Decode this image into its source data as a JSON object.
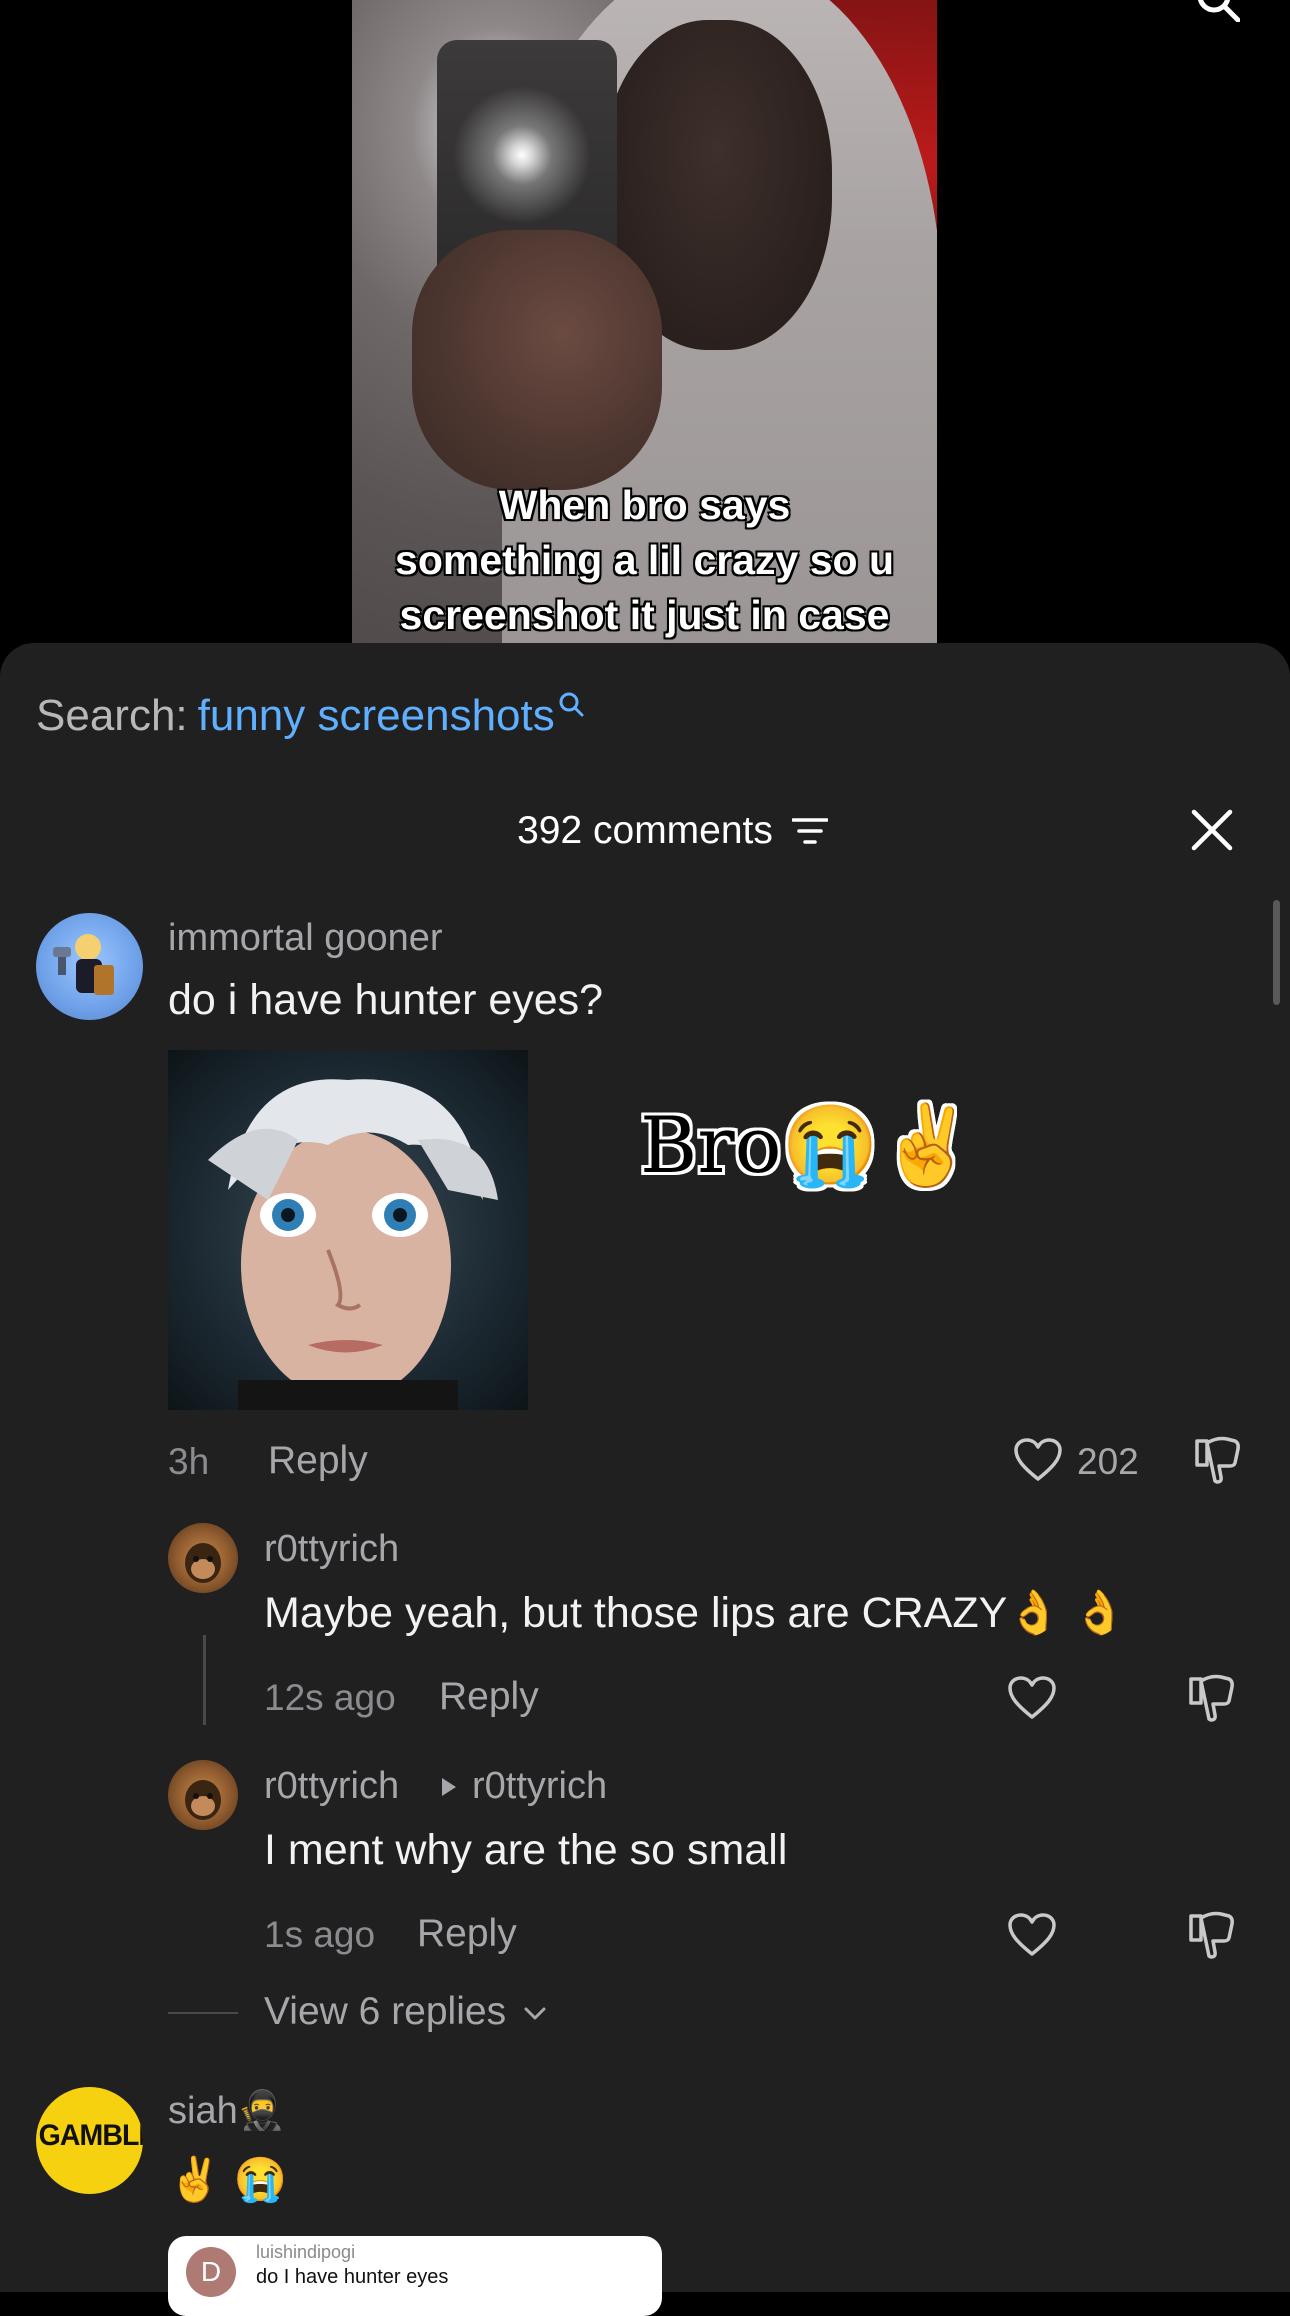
{
  "video": {
    "caption": "When bro says\nsomething a lil crazy so u\nscreenshot it just in case"
  },
  "search": {
    "prefix": "Search:",
    "term": "funny screenshots"
  },
  "comments_header": {
    "title": "392 comments"
  },
  "comments": [
    {
      "username": "immortal gooner",
      "text": "do i have hunter eyes?",
      "sticker_text": "Bro😭✌️",
      "time": "3h",
      "reply_label": "Reply",
      "likes": "202",
      "replies": [
        {
          "username": "r0ttyrich",
          "text": "Maybe yeah, but those lips are CRAZY👌 👌",
          "time": "12s ago",
          "reply_label": "Reply"
        },
        {
          "username": "r0ttyrich",
          "reply_to": "r0ttyrich",
          "text": "I ment why are the so small",
          "time": "1s ago",
          "reply_label": "Reply"
        }
      ],
      "view_replies": "View 6 replies"
    },
    {
      "username": "siah🥷",
      "avatar_text": "GAMBLING",
      "text": "✌️ 😭",
      "quoted": {
        "avatar_letter": "D",
        "username": "luishindipogi",
        "text": "do I have hunter eyes"
      }
    }
  ],
  "icons": {
    "search": "search-icon",
    "filter": "filter-icon",
    "close": "close-icon",
    "like": "heart-icon",
    "dislike": "thumbs-down-icon",
    "reply_arrow": "play-arrow-icon",
    "chevron": "chevron-down-icon"
  },
  "colors": {
    "sheet_bg": "#202021",
    "accent": "#5fb0ff"
  }
}
